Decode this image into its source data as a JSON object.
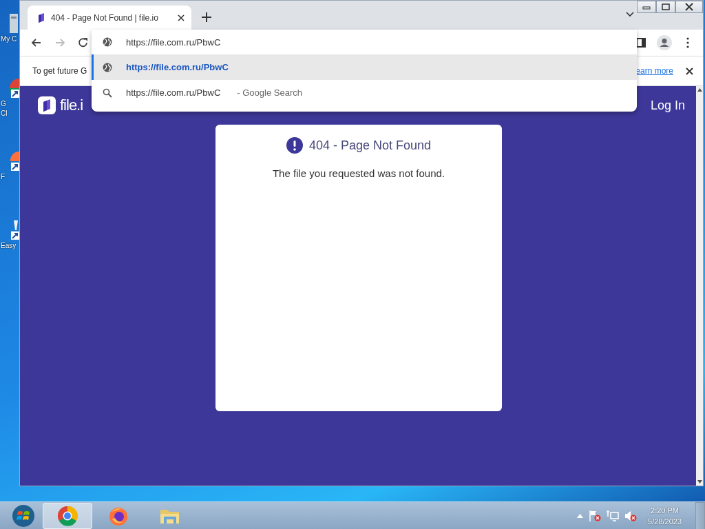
{
  "desktop": {
    "icons": [
      {
        "kind": "computer",
        "lines": [
          "My C"
        ]
      },
      {
        "kind": "chrome",
        "lines": [
          "G",
          "Cl"
        ]
      },
      {
        "kind": "firefox",
        "lines": [
          "F"
        ]
      },
      {
        "kind": "app",
        "lines": [
          "Easy"
        ]
      }
    ]
  },
  "browser": {
    "tabs": [
      {
        "title": "404 - Page Not Found | file.io",
        "selected": true
      }
    ],
    "address": {
      "value": "https://file.com.ru/PbwC"
    },
    "suggestions": [
      {
        "kind": "url",
        "text": "https://file.com.ru/PbwC",
        "selected": true
      },
      {
        "kind": "search",
        "text": "https://file.com.ru/PbwC",
        "suffix": "- Google Search",
        "selected": false
      }
    ],
    "infobar": {
      "text": "To get future G",
      "link": "earn more"
    },
    "page": {
      "logo": "file.i",
      "login": "Log In",
      "error": {
        "title": "404 - Page Not Found",
        "message": "The file you requested was not found."
      }
    }
  },
  "taskbar": {
    "apps": [
      {
        "kind": "chrome",
        "selected": true
      },
      {
        "kind": "firefox",
        "selected": false
      },
      {
        "kind": "explorer",
        "selected": false
      }
    ],
    "time": "2:20 PM",
    "date": "5/28/2023"
  }
}
